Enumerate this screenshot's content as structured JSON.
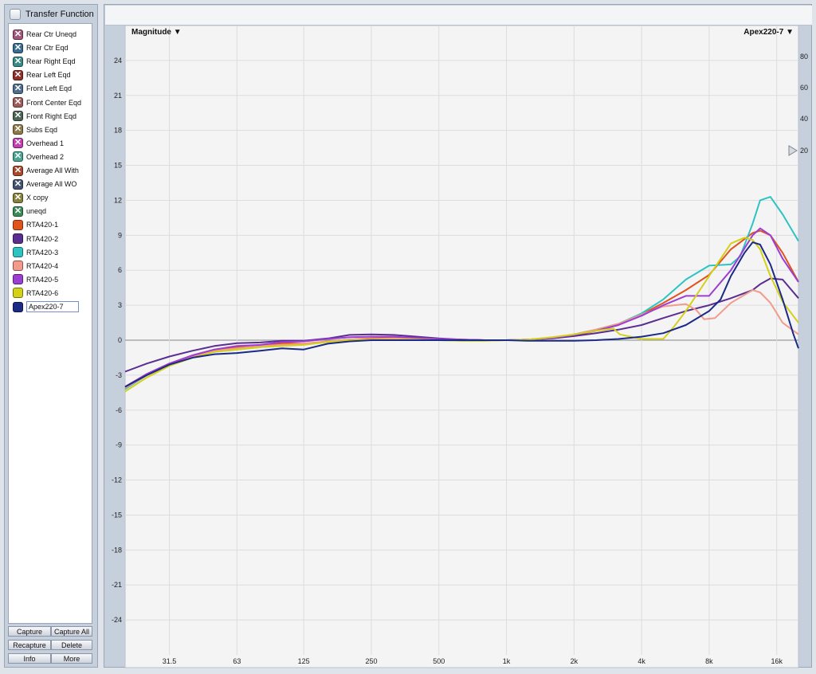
{
  "sidebar": {
    "title": "Transfer Function",
    "traces": [
      {
        "label": "Rear Ctr Uneqd",
        "color": "#a2567a",
        "kind": "x"
      },
      {
        "label": "Rear Ctr Eqd",
        "color": "#3a6c92",
        "kind": "x"
      },
      {
        "label": "Rear Right Eqd",
        "color": "#3b8a86",
        "kind": "x"
      },
      {
        "label": "Rear Left Eqd",
        "color": "#8e2f2a",
        "kind": "x"
      },
      {
        "label": "Front Left Eqd",
        "color": "#4e6d8e",
        "kind": "x"
      },
      {
        "label": "Front Center Eqd",
        "color": "#9e5b5b",
        "kind": "x"
      },
      {
        "label": "Front Right Eqd",
        "color": "#4e6455",
        "kind": "x"
      },
      {
        "label": "Subs Eqd",
        "color": "#8e7a49",
        "kind": "x"
      },
      {
        "label": "Overhead 1",
        "color": "#c23fb3",
        "kind": "x"
      },
      {
        "label": "Overhead 2",
        "color": "#4ca492",
        "kind": "x"
      },
      {
        "label": "Average All With",
        "color": "#a8492d",
        "kind": "x"
      },
      {
        "label": "Average All WO",
        "color": "#43526e",
        "kind": "x"
      },
      {
        "label": "X copy",
        "color": "#87813b",
        "kind": "x"
      },
      {
        "label": "uneqd",
        "color": "#3b8b5a",
        "kind": "x"
      },
      {
        "label": "RTA420-1",
        "color": "#e0531c",
        "kind": "solid"
      },
      {
        "label": "RTA420-2",
        "color": "#5a2d91",
        "kind": "solid"
      },
      {
        "label": "RTA420-3",
        "color": "#2ec3c3",
        "kind": "solid"
      },
      {
        "label": "RTA420-4",
        "color": "#f29a8c",
        "kind": "solid"
      },
      {
        "label": "RTA420-5",
        "color": "#9c3ed1",
        "kind": "solid"
      },
      {
        "label": "RTA420-6",
        "color": "#d3d11a",
        "kind": "solid"
      },
      {
        "label": "Apex220-7",
        "color": "#1b2a86",
        "kind": "solid",
        "selected": true
      }
    ],
    "buttons": {
      "capture": "Capture",
      "capture_all": "Capture All",
      "recapture": "Recapture",
      "delete": "Delete",
      "info": "Info",
      "more": "More"
    }
  },
  "chart_data": {
    "type": "line",
    "title_left": "Magnitude ▼",
    "title_right": "Apex220-7 ▼",
    "xscale": "log",
    "xlim": [
      20,
      20000
    ],
    "ylim": [
      -27,
      27
    ],
    "x_ticks": [
      31.5,
      63,
      125,
      250,
      500,
      1000,
      2000,
      4000,
      8000,
      16000
    ],
    "x_tick_labels": [
      "31.5",
      "63",
      "125",
      "250",
      "500",
      "1k",
      "2k",
      "4k",
      "8k",
      "16k"
    ],
    "y_ticks": [
      -24,
      -21,
      -18,
      -15,
      -12,
      -9,
      -6,
      -3,
      0,
      3,
      6,
      9,
      12,
      15,
      18,
      21,
      24
    ],
    "y_tick_labels": [
      "-24",
      "-21",
      "-18",
      "-15",
      "-12",
      "-9",
      "-6",
      "-3",
      "0",
      "3",
      "6",
      "9",
      "12",
      "15",
      "18",
      "21",
      "24"
    ],
    "right_axis_labels": [
      "80",
      "60",
      "40",
      "20"
    ],
    "grid": true,
    "series": [
      {
        "name": "RTA420-1",
        "color": "#e0531c",
        "x": [
          20,
          25,
          31.5,
          40,
          50,
          63,
          80,
          100,
          125,
          160,
          200,
          250,
          315,
          400,
          500,
          630,
          800,
          1000,
          1250,
          1600,
          2000,
          2500,
          3150,
          4000,
          5000,
          6300,
          8000,
          10000,
          12500,
          13500,
          15000,
          17000,
          20000
        ],
        "y": [
          -4,
          -2.9,
          -2.0,
          -1.3,
          -0.8,
          -0.6,
          -0.45,
          -0.25,
          -0.3,
          -0.1,
          0.05,
          0.15,
          0.2,
          0.15,
          0.1,
          0.05,
          0,
          0,
          0.05,
          0.15,
          0.4,
          0.8,
          1.3,
          2.2,
          3.2,
          4.3,
          5.6,
          7.8,
          9.2,
          9.4,
          9.0,
          7.5,
          5.0
        ]
      },
      {
        "name": "RTA420-2",
        "color": "#5a2d91",
        "x": [
          20,
          25,
          31.5,
          40,
          50,
          63,
          80,
          100,
          125,
          160,
          200,
          250,
          315,
          400,
          500,
          630,
          800,
          1000,
          1250,
          1600,
          2000,
          2500,
          3150,
          4000,
          5000,
          6300,
          8000,
          10000,
          12500,
          13500,
          15000,
          17000,
          20000
        ],
        "y": [
          -2.7,
          -2.0,
          -1.4,
          -0.9,
          -0.5,
          -0.25,
          -0.2,
          -0.05,
          -0.05,
          0.15,
          0.45,
          0.5,
          0.45,
          0.3,
          0.15,
          0.05,
          0,
          0,
          0.05,
          0.15,
          0.35,
          0.6,
          0.9,
          1.3,
          1.9,
          2.5,
          3.0,
          3.6,
          4.3,
          4.8,
          5.3,
          5.2,
          3.6
        ]
      },
      {
        "name": "RTA420-3",
        "color": "#2ec3c3",
        "x": [
          20,
          25,
          31.5,
          40,
          50,
          63,
          80,
          100,
          125,
          160,
          200,
          250,
          315,
          400,
          500,
          630,
          800,
          1000,
          1250,
          1600,
          2000,
          2500,
          3150,
          4000,
          5000,
          6300,
          8000,
          10000,
          11000,
          12500,
          13500,
          15000,
          17000,
          20000
        ],
        "y": [
          -4.2,
          -3.0,
          -2.1,
          -1.4,
          -1.0,
          -0.8,
          -0.6,
          -0.45,
          -0.35,
          -0.1,
          0.05,
          0.05,
          0.05,
          0.05,
          0,
          -0.05,
          -0.05,
          0,
          0.05,
          0.2,
          0.5,
          0.9,
          1.4,
          2.3,
          3.5,
          5.2,
          6.4,
          6.5,
          7.2,
          10.0,
          12.0,
          12.3,
          10.8,
          8.5
        ]
      },
      {
        "name": "RTA420-4",
        "color": "#f29a8c",
        "x": [
          20,
          25,
          31.5,
          40,
          50,
          63,
          80,
          100,
          125,
          160,
          200,
          250,
          315,
          400,
          500,
          630,
          800,
          1000,
          1250,
          1600,
          2000,
          2500,
          3150,
          4000,
          5000,
          6300,
          7000,
          7600,
          8500,
          10000,
          12500,
          13500,
          15000,
          17000,
          20000
        ],
        "y": [
          -4.1,
          -3.0,
          -2.1,
          -1.4,
          -0.9,
          -0.7,
          -0.5,
          -0.4,
          -0.3,
          -0.1,
          0.05,
          0.1,
          0.15,
          0.1,
          0.05,
          0,
          0,
          0,
          0.05,
          0.2,
          0.5,
          0.9,
          1.4,
          2.2,
          2.9,
          3.1,
          2.6,
          1.8,
          1.9,
          3.2,
          4.3,
          4.1,
          3.2,
          1.5,
          0.5
        ]
      },
      {
        "name": "RTA420-5",
        "color": "#9c3ed1",
        "x": [
          20,
          25,
          31.5,
          40,
          50,
          63,
          80,
          100,
          125,
          160,
          200,
          250,
          315,
          400,
          500,
          630,
          800,
          1000,
          1250,
          1600,
          2000,
          2500,
          3150,
          4000,
          5000,
          6300,
          8000,
          10000,
          12500,
          13500,
          15000,
          17000,
          20000
        ],
        "y": [
          -4,
          -2.9,
          -2.0,
          -1.3,
          -0.8,
          -0.5,
          -0.4,
          -0.15,
          -0.1,
          0.1,
          0.25,
          0.3,
          0.3,
          0.2,
          0.1,
          0.05,
          0,
          0,
          0.05,
          0.2,
          0.45,
          0.8,
          1.3,
          2.1,
          3.0,
          3.8,
          3.8,
          6.0,
          9.0,
          9.6,
          9.0,
          7.0,
          5.0
        ]
      },
      {
        "name": "RTA420-6",
        "color": "#d3d11a",
        "x": [
          20,
          25,
          31.5,
          40,
          50,
          63,
          80,
          100,
          125,
          160,
          200,
          250,
          315,
          400,
          500,
          630,
          800,
          1000,
          1250,
          1600,
          2000,
          2500,
          3000,
          3200,
          4000,
          5000,
          5600,
          6300,
          8000,
          10000,
          11500,
          12500,
          13500,
          15000,
          17000,
          20000
        ],
        "y": [
          -4.4,
          -3.2,
          -2.2,
          -1.5,
          -1.0,
          -0.8,
          -0.6,
          -0.5,
          -0.4,
          -0.15,
          0,
          0.05,
          0.05,
          0.05,
          0,
          -0.05,
          -0.05,
          0,
          0.05,
          0.25,
          0.5,
          0.8,
          1.0,
          0.5,
          0.1,
          0.1,
          1.2,
          2.5,
          5.5,
          8.3,
          8.8,
          8.6,
          7.8,
          5.5,
          3.3,
          1.5
        ]
      },
      {
        "name": "Apex220-7",
        "color": "#1b2a86",
        "x": [
          20,
          25,
          31.5,
          40,
          50,
          63,
          80,
          100,
          125,
          160,
          200,
          250,
          315,
          400,
          500,
          630,
          800,
          1000,
          1250,
          1600,
          2000,
          2500,
          3150,
          4000,
          5000,
          6300,
          8000,
          9000,
          10000,
          11500,
          12500,
          13500,
          15000,
          17000,
          19000,
          20000
        ],
        "y": [
          -4.0,
          -3.0,
          -2.1,
          -1.5,
          -1.2,
          -1.1,
          -0.9,
          -0.7,
          -0.8,
          -0.3,
          -0.1,
          0,
          0,
          0,
          0,
          0,
          0,
          0,
          -0.05,
          -0.05,
          -0.05,
          0,
          0.1,
          0.3,
          0.6,
          1.3,
          2.5,
          3.5,
          5.5,
          7.5,
          8.4,
          8.2,
          6.5,
          3.5,
          0.5,
          -0.7
        ]
      }
    ]
  }
}
